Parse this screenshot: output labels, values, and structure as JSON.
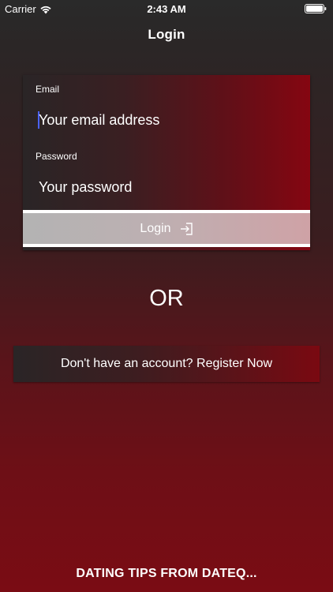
{
  "status_bar": {
    "carrier": "Carrier",
    "time": "2:43 AM",
    "wifi_icon": "wifi-icon",
    "battery_icon": "battery-icon"
  },
  "nav": {
    "title": "Login"
  },
  "form": {
    "email_label": "Email",
    "email_placeholder": "Your email address",
    "email_value": "",
    "password_label": "Password",
    "password_placeholder": "Your password",
    "password_value": "",
    "login_label": "Login",
    "login_icon": "login-arrow-icon"
  },
  "divider": {
    "or_text": "OR"
  },
  "register": {
    "label": "Don't have an account? Register Now"
  },
  "footer": {
    "label": "DATING TIPS FROM DATEQ..."
  },
  "colors": {
    "accent_red": "#850611",
    "caret_blue": "#4a62ff",
    "button_gray": "#b3b3b3"
  }
}
